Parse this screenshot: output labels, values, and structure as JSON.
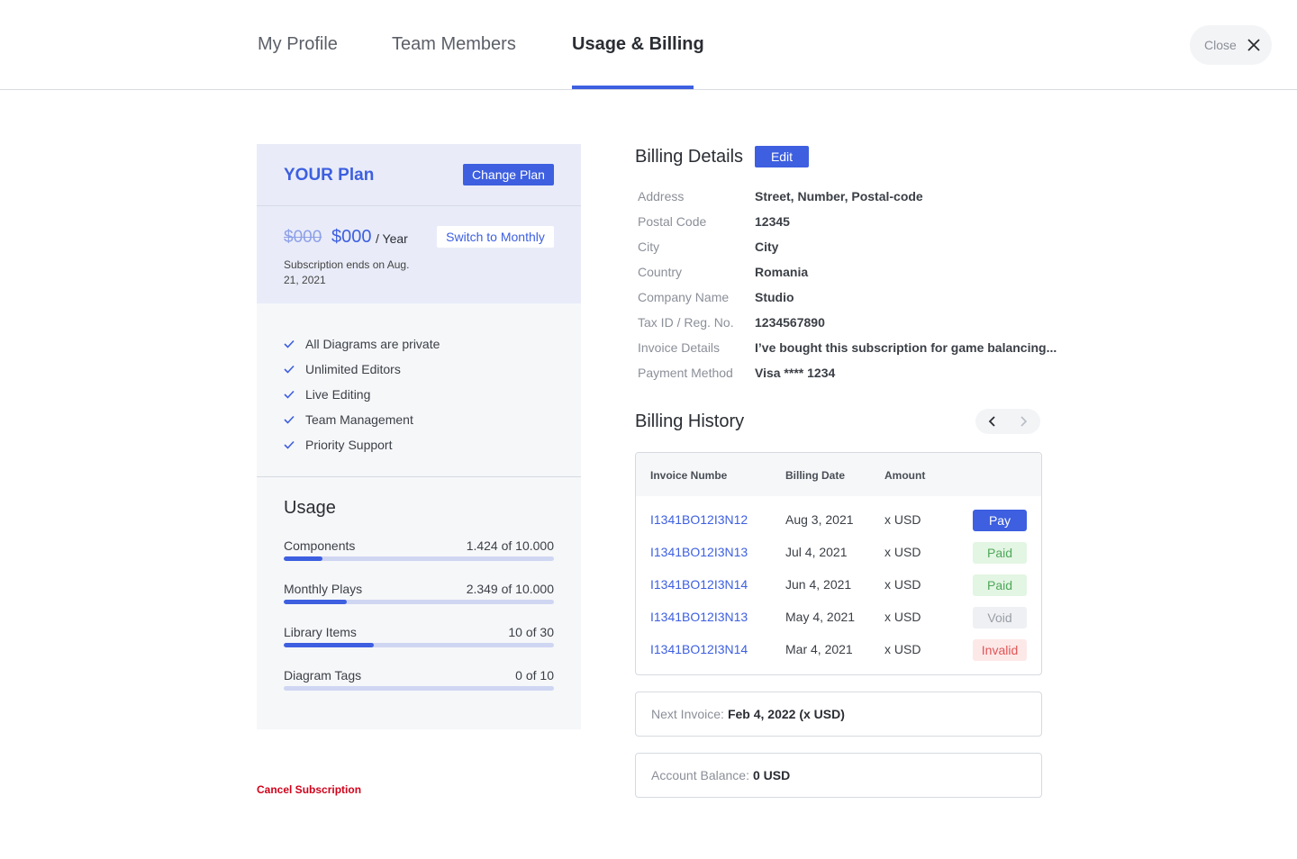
{
  "header": {
    "tabs": [
      {
        "label": "My Profile"
      },
      {
        "label": "Team Members"
      },
      {
        "label": "Usage & Billing"
      }
    ],
    "active_tab": "Usage & Billing",
    "close_label": "Close"
  },
  "plan": {
    "title": "YOUR Plan",
    "change_plan_label": "Change Plan",
    "old_price": "$000",
    "price": "$000",
    "period": "/ Year",
    "switch_label": "Switch to Monthly",
    "subscription_ends": "Subscription ends on Aug. 21, 2021",
    "features": [
      "All Diagrams are private",
      "Unlimited Editors",
      "Live Editing",
      "Team Management",
      "Priority Support"
    ]
  },
  "usage": {
    "title": "Usage",
    "items": [
      {
        "label": "Components",
        "value": "1.424 of 10.000",
        "fraction": 0.1424
      },
      {
        "label": "Monthly Plays",
        "value": "2.349 of 10.000",
        "fraction": 0.2349
      },
      {
        "label": "Library Items",
        "value": "10 of 30",
        "fraction": 0.3333
      },
      {
        "label": "Diagram Tags",
        "value": "0 of 10",
        "fraction": 0
      }
    ]
  },
  "cancel_label": "Cancel Subscription",
  "billing_details": {
    "title": "Billing Details",
    "edit_label": "Edit",
    "rows": [
      {
        "key": "Address",
        "value": "Street, Number, Postal-code"
      },
      {
        "key": "Postal Code",
        "value": "12345"
      },
      {
        "key": "City",
        "value": "City"
      },
      {
        "key": "Country",
        "value": "Romania"
      },
      {
        "key": "Company Name",
        "value": "Studio"
      },
      {
        "key": "Tax ID / Reg. No.",
        "value": "1234567890"
      },
      {
        "key": "Invoice Details",
        "value": "I’ve bought this subscription for game balancing..."
      },
      {
        "key": "Payment Method",
        "value": "Visa **** 1234"
      }
    ]
  },
  "billing_history": {
    "title": "Billing History",
    "columns": [
      "Invoice Numbe",
      "Billing Date",
      "Amount"
    ],
    "rows": [
      {
        "invoice": "I1341BO12I3N12",
        "date": "Aug 3, 2021",
        "amount": "x USD",
        "status": "Pay",
        "kind": "pay"
      },
      {
        "invoice": "I1341BO12I3N13",
        "date": "Jul 4, 2021",
        "amount": "x USD",
        "status": "Paid",
        "kind": "paid"
      },
      {
        "invoice": "I1341BO12I3N14",
        "date": "Jun 4, 2021",
        "amount": "x USD",
        "status": "Paid",
        "kind": "paid"
      },
      {
        "invoice": "I1341BO12I3N13",
        "date": "May 4, 2021",
        "amount": "x USD",
        "status": "Void",
        "kind": "void"
      },
      {
        "invoice": "I1341BO12I3N14",
        "date": "Mar 4, 2021",
        "amount": "x USD",
        "status": "Invalid",
        "kind": "invalid"
      }
    ],
    "next_invoice_label": "Next Invoice:",
    "next_invoice_value": "Feb 4, 2022 (x USD)",
    "balance_label": "Account Balance:",
    "balance_value": "0 USD"
  },
  "colors": {
    "accent": "#3d5fe0",
    "danger": "#d0021b",
    "paid": "#4fa85a",
    "invalid": "#e05555"
  }
}
